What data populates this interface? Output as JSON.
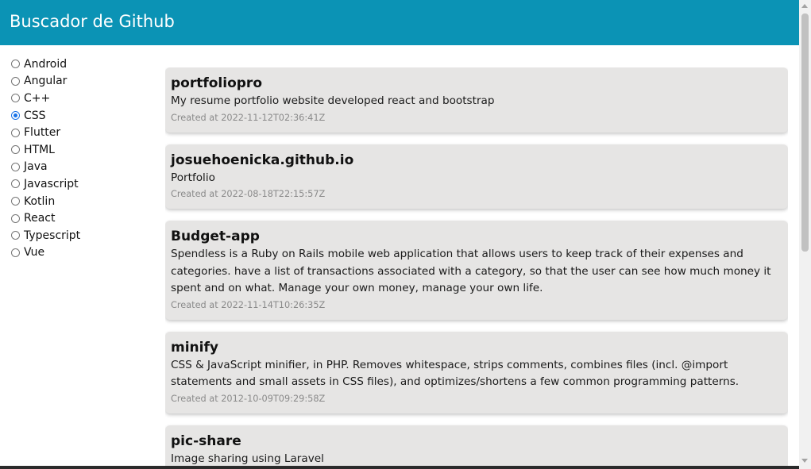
{
  "header": {
    "title": "Buscador de Github"
  },
  "filters": {
    "selected": "CSS",
    "options": [
      "Android",
      "Angular",
      "C++",
      "CSS",
      "Flutter",
      "HTML",
      "Java",
      "Javascript",
      "Kotlin",
      "React",
      "Typescript",
      "Vue"
    ]
  },
  "repos": [
    {
      "name": "portfoliopro",
      "description": "My resume portfolio website developed react and bootstrap",
      "created": "Created at 2022-11-12T02:36:41Z"
    },
    {
      "name": "josuehoenicka.github.io",
      "description": "Portfolio",
      "created": "Created at 2022-08-18T22:15:57Z"
    },
    {
      "name": "Budget-app",
      "description": "Spendless is a Ruby on Rails mobile web application that allows users to keep track of their expenses and categories. have a list of transactions associated with a category, so that the user can see how much money it spent and on what. Manage your own money, manage your own life.",
      "created": "Created at 2022-11-14T10:26:35Z"
    },
    {
      "name": "minify",
      "description": "CSS & JavaScript minifier, in PHP. Removes whitespace, strips comments, combines files (incl. @import statements and small assets in CSS files), and optimizes/shortens a few common programming patterns.",
      "created": "Created at 2012-10-09T09:29:58Z"
    },
    {
      "name": "pic-share",
      "description": "Image sharing using Laravel",
      "created": ""
    }
  ]
}
